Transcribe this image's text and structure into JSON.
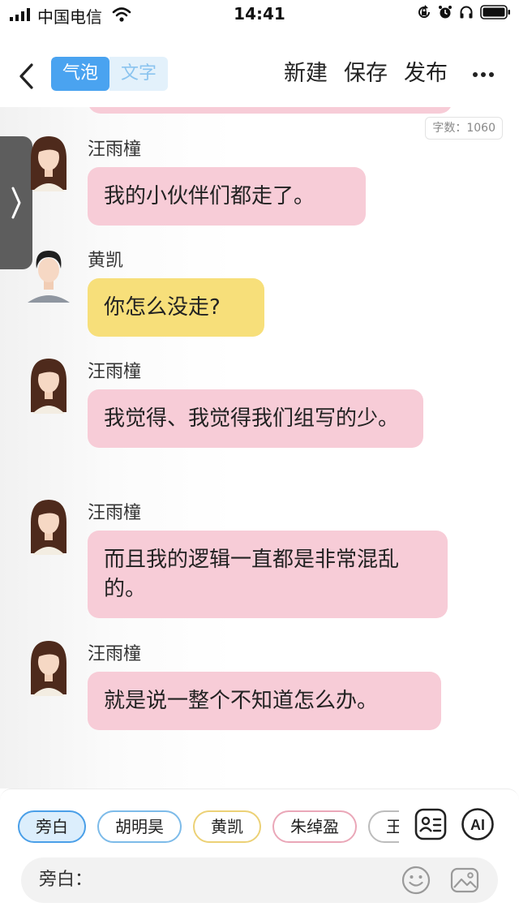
{
  "status": {
    "carrier": "中国电信",
    "time": "14:41",
    "icons": [
      "signal-icon",
      "wifi-icon",
      "rotation-lock-icon",
      "alarm-icon",
      "headphones-icon",
      "battery-icon"
    ]
  },
  "nav": {
    "tabs": [
      {
        "label": "气泡",
        "active": true
      },
      {
        "label": "文字",
        "active": false
      }
    ],
    "actions": {
      "new": "新建",
      "save": "保存",
      "publish": "发布"
    }
  },
  "editor": {
    "word_count": "字数：1060"
  },
  "messages": [
    {
      "sender": "汪雨橦",
      "text": "我的小伙伴们都走了。",
      "color": "#f7ccd7"
    },
    {
      "sender": "黄凯",
      "text": "你怎么没走?",
      "color": "#f7df7a"
    },
    {
      "sender": "汪雨橦",
      "text": "我觉得、我觉得我们组写的少。",
      "color": "#f7ccd7"
    },
    {
      "sender": "汪雨橦",
      "text": "而且我的逻辑一直都是非常混乱的。",
      "color": "#f7ccd7"
    },
    {
      "sender": "汪雨橦",
      "text": "就是说一整个不知道怎么办。",
      "color": "#f7ccd7"
    }
  ],
  "characters": [
    {
      "label": "旁白",
      "selected": true
    },
    {
      "label": "胡明昊",
      "selected": false
    },
    {
      "label": "黄凯",
      "selected": false
    },
    {
      "label": "朱绰盈",
      "selected": false
    },
    {
      "label": "王芸",
      "selected": false
    }
  ],
  "toolbar": {
    "ai_label": "AI"
  },
  "input": {
    "prefix": "旁白："
  }
}
